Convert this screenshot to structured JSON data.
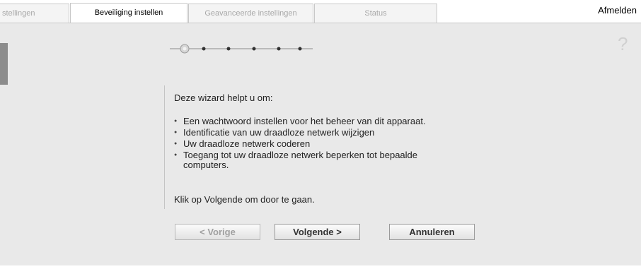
{
  "tabs": [
    {
      "label": "stellingen",
      "active": false
    },
    {
      "label": "Beveiliging instellen",
      "active": true
    },
    {
      "label": "Geavanceerde instellingen",
      "active": false
    },
    {
      "label": "Status",
      "active": false
    }
  ],
  "header": {
    "logout_label": "Afmelden"
  },
  "help": {
    "icon": "help-question-icon",
    "glyph": "?"
  },
  "wizard": {
    "step_current": 1,
    "step_total": 6,
    "intro": "Deze wizard helpt u om:",
    "items": [
      "Een wachtwoord instellen voor het beheer van dit apparaat.",
      "Identificatie van uw draadloze netwerk wijzigen",
      "Uw draadloze netwerk coderen",
      "Toegang tot uw draadloze netwerk beperken tot bepaalde",
      "computers."
    ],
    "continue_text": "Klik op Volgende om door te gaan."
  },
  "buttons": {
    "prev": "< Vorige",
    "next": "Volgende >",
    "cancel": "Annuleren"
  }
}
